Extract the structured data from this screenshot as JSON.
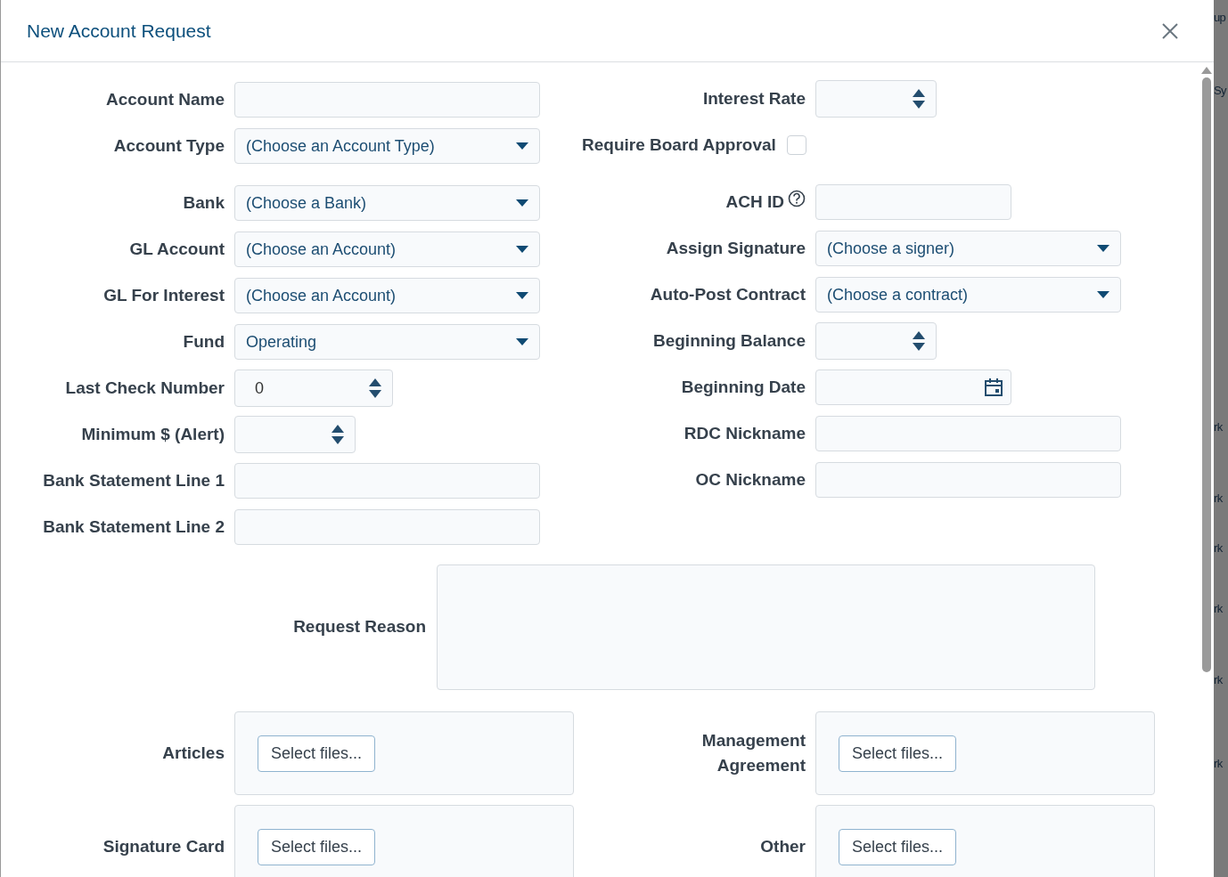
{
  "dialog": {
    "title": "New Account Request"
  },
  "left_fields": [
    {
      "kind": "text",
      "label": "Account Name"
    },
    {
      "kind": "select",
      "label": "Account Type",
      "value": "(Choose an Account Type)"
    },
    {
      "kind": "select",
      "label": "Bank",
      "value": "(Choose a Bank)"
    },
    {
      "kind": "select",
      "label": "GL Account",
      "value": "(Choose an Account)"
    },
    {
      "kind": "select",
      "label": "GL For Interest",
      "value": "(Choose an Account)"
    },
    {
      "kind": "select",
      "label": "Fund",
      "value": "Operating"
    },
    {
      "kind": "number",
      "label": "Last Check Number",
      "value": "0"
    },
    {
      "kind": "number",
      "label": "Minimum $ (Alert)"
    },
    {
      "kind": "text",
      "label": "Bank Statement Line 1"
    },
    {
      "kind": "text",
      "label": "Bank Statement Line 2"
    }
  ],
  "right_fields": [
    {
      "kind": "number",
      "label": "Interest Rate"
    },
    {
      "kind": "checkbox",
      "label": "Require Board Approval",
      "checked": false
    },
    {
      "kind": "text",
      "label": "ACH ID",
      "help": true
    },
    {
      "kind": "select",
      "label": "Assign Signature",
      "value": "(Choose a signer)"
    },
    {
      "kind": "select",
      "label": "Auto-Post Contract",
      "value": "(Choose a contract)"
    },
    {
      "kind": "number",
      "label": "Beginning Balance"
    },
    {
      "kind": "date",
      "label": "Beginning Date"
    },
    {
      "kind": "text",
      "label": "RDC Nickname"
    },
    {
      "kind": "text",
      "label": "OC Nickname"
    }
  ],
  "request_reason": {
    "label": "Request Reason"
  },
  "upload_rows": [
    {
      "left": {
        "label": "Articles",
        "button": "Select files..."
      },
      "right": {
        "label": "Management Agreement",
        "button": "Select files..."
      }
    },
    {
      "left": {
        "label": "Signature Card",
        "button": "Select files..."
      },
      "right": {
        "label": "Other",
        "button": "Select files..."
      }
    }
  ],
  "background_fragments": [
    "up",
    "Sy",
    "rk",
    "rk",
    "rk",
    "rk",
    "rk",
    "rk"
  ]
}
